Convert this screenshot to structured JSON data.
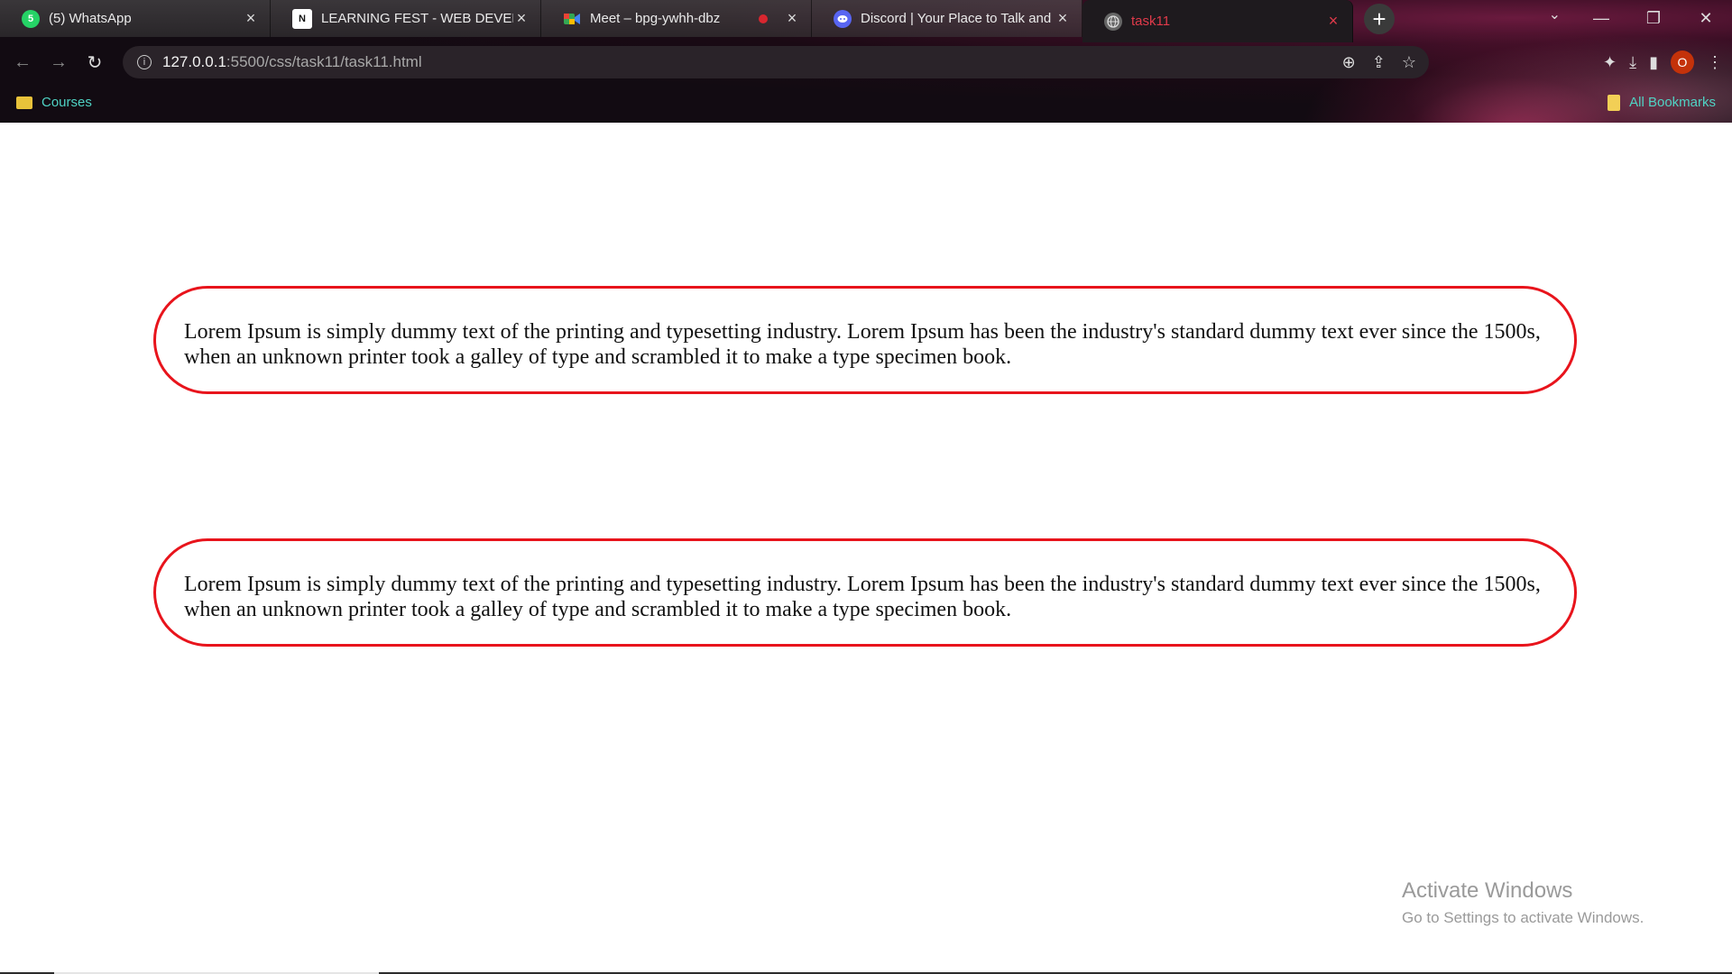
{
  "tabs": [
    {
      "label": "(5) WhatsApp",
      "icon": "whatsapp-icon",
      "badge": "5",
      "color": "#25d366"
    },
    {
      "label": "LEARNING FEST - WEB DEVELOP",
      "icon": "notion-icon",
      "badge": "N",
      "color": "#ffffff"
    },
    {
      "label": "Meet – bpg-ywhh-dbz",
      "icon": "google-meet-icon",
      "color": "#34a853"
    },
    {
      "label": "Discord | Your Place to Talk and",
      "icon": "discord-icon",
      "color": "#5865f2"
    },
    {
      "label": "task11",
      "icon": "globe-icon",
      "active": true
    }
  ],
  "address_bar": {
    "host": "127.0.0.1",
    "path": ":5500/css/task11/task11.html"
  },
  "profile": {
    "initial": "O",
    "color": "#c4320a"
  },
  "bookmarks": {
    "courses": "Courses",
    "all": "All Bookmarks"
  },
  "page": {
    "paragraphs": [
      "Lorem Ipsum is simply dummy text of the printing and typesetting industry. Lorem Ipsum has been the industry's standard dummy text ever since the 1500s, when an unknown printer took a galley of type and scrambled it to make a type specimen book.",
      "Lorem Ipsum is simply dummy text of the printing and typesetting industry. Lorem Ipsum has been the industry's standard dummy text ever since the 1500s, when an unknown printer took a galley of type and scrambled it to make a type specimen book."
    ],
    "border_color": "#e8141c"
  },
  "watermark": {
    "title": "Activate Windows",
    "subtitle": "Go to Settings to activate Windows."
  }
}
